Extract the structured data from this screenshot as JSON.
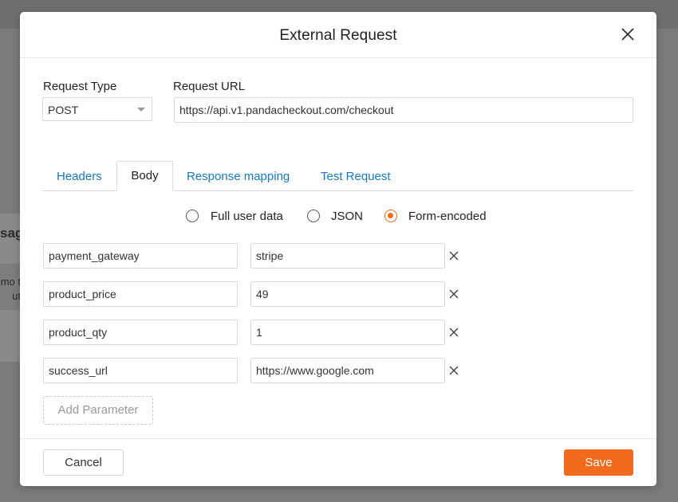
{
  "background": {
    "card_title": "sag",
    "card_lines": [
      "mo t",
      "ut"
    ]
  },
  "modal": {
    "title": "External Request",
    "request_type_label": "Request Type",
    "request_type_value": "POST",
    "request_url_label": "Request URL",
    "request_url_value": "https://api.v1.pandacheckout.com/checkout",
    "tabs": [
      {
        "label": "Headers",
        "active": false
      },
      {
        "label": "Body",
        "active": true
      },
      {
        "label": "Response mapping",
        "active": false
      },
      {
        "label": "Test Request",
        "active": false
      }
    ],
    "body_modes": [
      {
        "label": "Full user data",
        "checked": false
      },
      {
        "label": "JSON",
        "checked": false
      },
      {
        "label": "Form-encoded",
        "checked": true
      }
    ],
    "params": [
      {
        "key": "payment_gateway",
        "value": "stripe"
      },
      {
        "key": "product_price",
        "value": "49"
      },
      {
        "key": "product_qty",
        "value": "1"
      },
      {
        "key": "success_url",
        "value": "https://www.google.com"
      }
    ],
    "add_parameter_label": "Add Parameter",
    "cancel_label": "Cancel",
    "save_label": "Save"
  },
  "colors": {
    "accent": "#f26b1d",
    "link": "#1677c8"
  }
}
